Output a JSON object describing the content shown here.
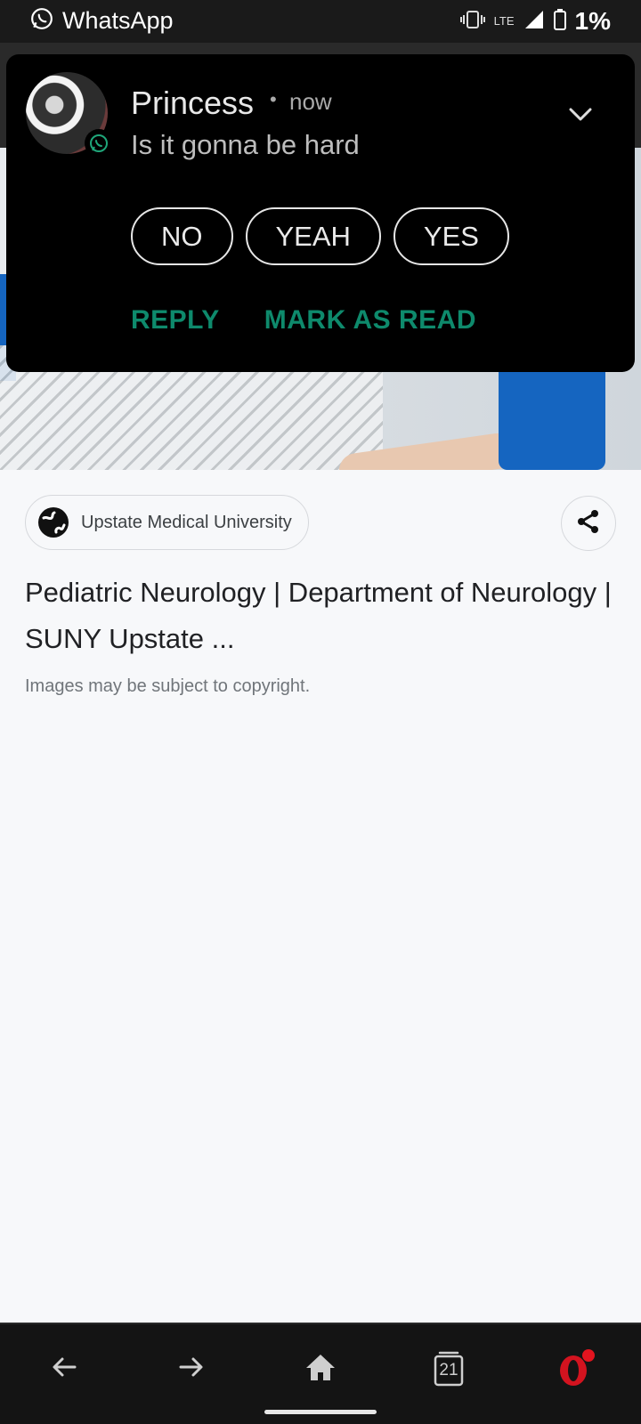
{
  "status_bar": {
    "app_name": "WhatsApp",
    "network": "LTE",
    "battery": "1%"
  },
  "notification": {
    "sender": "Princess",
    "separator": "•",
    "time": "now",
    "message": "Is it gonna be hard",
    "quick_replies": [
      "NO",
      "YEAH",
      "YES"
    ],
    "actions": {
      "reply": "REPLY",
      "mark_as_read": "MARK AS READ"
    },
    "accent": "#0e8a6c"
  },
  "result": {
    "source": "Upstate Medical University",
    "title": "Pediatric Neurology | Department of Neurology | SUNY Upstate ...",
    "copyright_note": "Images may be subject to copyright."
  },
  "bottom_nav": {
    "tabs_count": "21",
    "icons": [
      "back-arrow-icon",
      "forward-arrow-icon",
      "home-icon",
      "tabs-icon",
      "opera-icon"
    ]
  }
}
